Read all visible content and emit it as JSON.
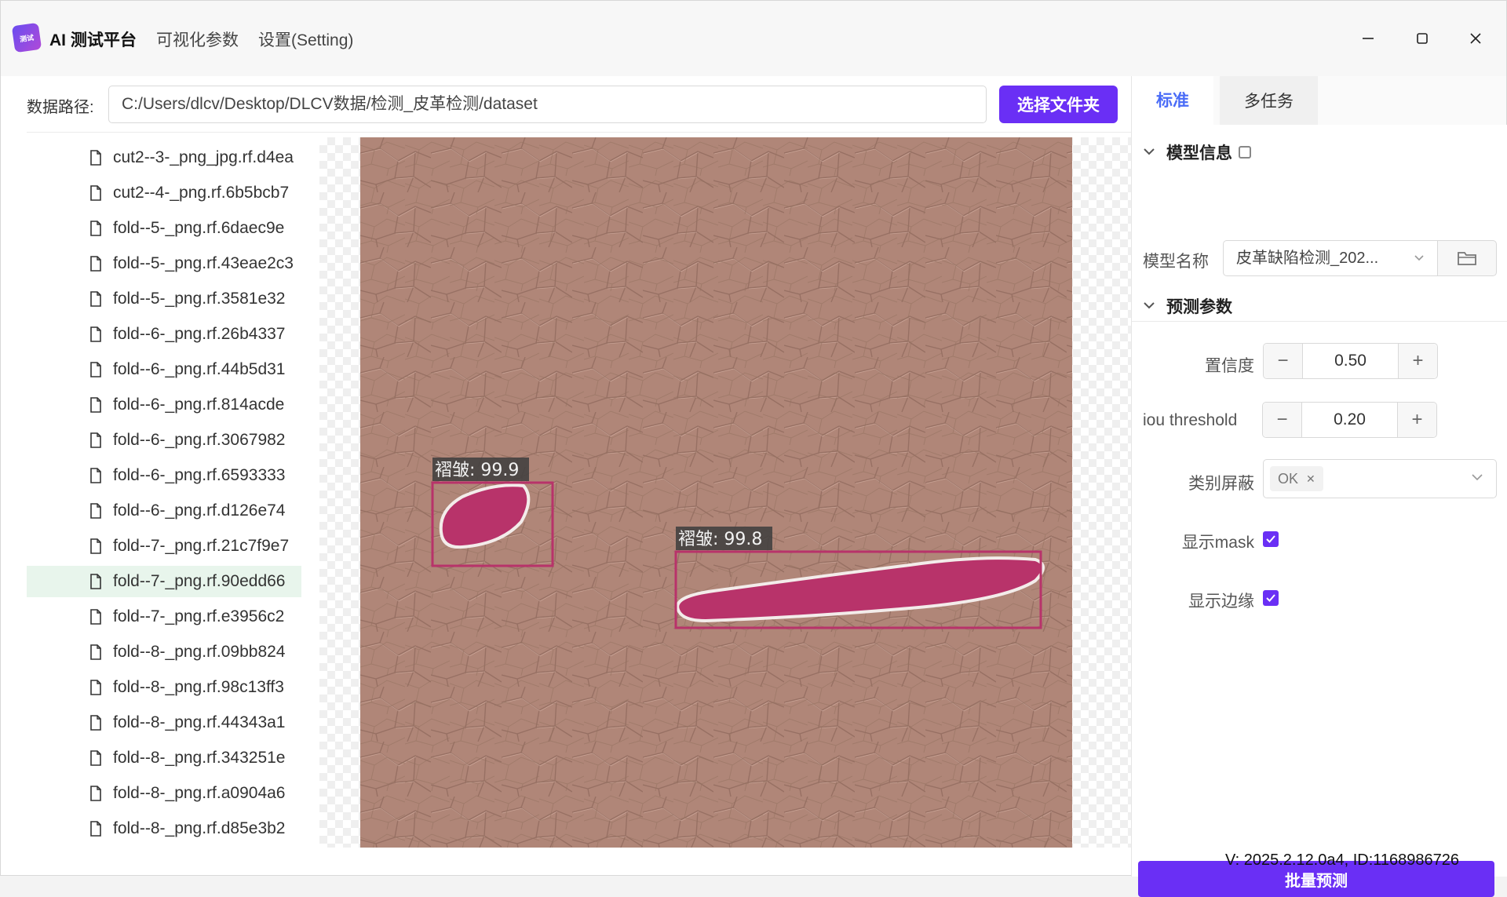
{
  "titlebar": {
    "logo_text": "测试",
    "app_title": "AI 测试平台",
    "menu": [
      "可视化参数",
      "设置(Setting)"
    ]
  },
  "path": {
    "label": "数据路径:",
    "value": "C:/Users/dlcv/Desktop/DLCV数据/检测_皮革检测/dataset",
    "select_button": "选择文件夹"
  },
  "files": [
    "cut2--3-_png_jpg.rf.d4ea",
    "cut2--4-_png.rf.6b5bcb7",
    "fold--5-_png.rf.6daec9e",
    "fold--5-_png.rf.43eae2c3",
    "fold--5-_png.rf.3581e32",
    "fold--6-_png.rf.26b4337",
    "fold--6-_png.rf.44b5d31",
    "fold--6-_png.rf.814acde",
    "fold--6-_png.rf.3067982",
    "fold--6-_png.rf.6593333",
    "fold--6-_png.rf.d126e74",
    "fold--7-_png.rf.21c7f9e7",
    "fold--7-_png.rf.90edd66",
    "fold--7-_png.rf.e3956c2",
    "fold--8-_png.rf.09bb824",
    "fold--8-_png.rf.98c13ff3",
    "fold--8-_png.rf.44343a1",
    "fold--8-_png.rf.343251e",
    "fold--8-_png.rf.a0904a6",
    "fold--8-_png.rf.d85e3b2"
  ],
  "selected_file_index": 12,
  "detections": [
    {
      "label": "褶皱: 99.9"
    },
    {
      "label": "褶皱: 99.8"
    }
  ],
  "panel": {
    "tabs": [
      "标准",
      "多任务"
    ],
    "model_section": "模型信息",
    "model_label": "模型名称",
    "model_value": "皮革缺陷检测_202...",
    "predict_section": "预测参数",
    "confidence_label": "置信度",
    "confidence_value": "0.50",
    "iou_label": "iou threshold",
    "iou_value": "0.20",
    "mask_class_label": "类别屏蔽",
    "mask_class_tag": "OK",
    "show_mask_label": "显示mask",
    "show_mask_checked": true,
    "show_edge_label": "显示边缘",
    "show_edge_checked": true,
    "batch_button": "批量预测"
  },
  "version": "V: 2025.2.12.0a4, ID:1168986726",
  "colors": {
    "accent": "#6a2ff5",
    "tab_active": "#4a6cf7",
    "detection": "#b8336a",
    "leather": "#b08678"
  }
}
